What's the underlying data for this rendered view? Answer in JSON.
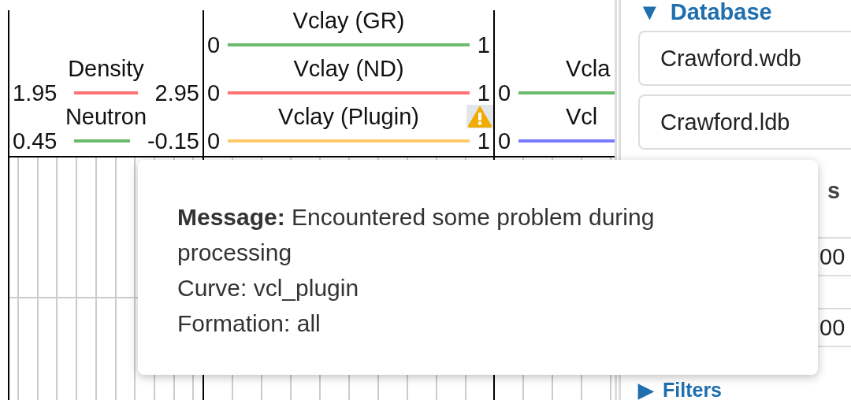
{
  "log_tracks": [
    {
      "curves": [
        {
          "name": "Density",
          "min": "1.95",
          "max": "2.95",
          "color": "#ff7373",
          "warning": false
        },
        {
          "name": "Neutron",
          "min": "0.45",
          "max": "-0.15",
          "color": "#6cba6c",
          "warning": false
        }
      ]
    },
    {
      "curves": [
        {
          "name": "Vclay (GR)",
          "min": "0",
          "max": "1",
          "color": "#6cba6c",
          "warning": false
        },
        {
          "name": "Vclay (ND)",
          "min": "0",
          "max": "1",
          "color": "#ff7373",
          "warning": false
        },
        {
          "name": "Vclay (Plugin)",
          "min": "0",
          "max": "1",
          "color": "#ffca6a",
          "warning": true
        }
      ]
    },
    {
      "curves": [
        {
          "name": "Vcla",
          "min": "0",
          "color": "#6cba6c",
          "warning": false
        },
        {
          "name": "Vcl",
          "min": "0",
          "color": "#7a7aff",
          "warning": false
        }
      ]
    }
  ],
  "side_panel": {
    "sections": [
      {
        "toggle": "▼",
        "title": "Database",
        "expanded": true,
        "fields": [
          "Crawford.wdb",
          "Crawford.ldb"
        ]
      },
      {
        "title": "s",
        "expanded": true,
        "fields": [
          "00",
          "00"
        ]
      },
      {
        "toggle": "▶",
        "title": "Filters",
        "expanded": false
      }
    ]
  },
  "tooltip": {
    "lines": [
      "**Message:** Encountered some problem during processing",
      "Curve: vcl_plugin",
      "Formation: all"
    ]
  }
}
